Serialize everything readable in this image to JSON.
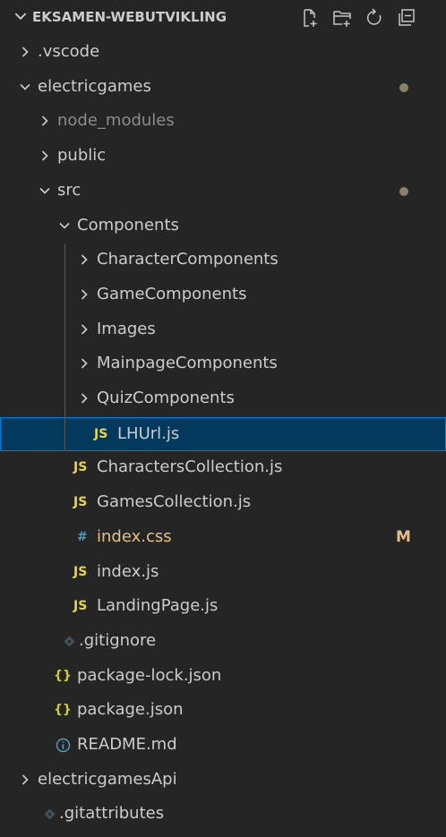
{
  "explorer": {
    "title": "EKSAMEN-WEBUTVIKLING",
    "actions": [
      {
        "name": "new-file-icon"
      },
      {
        "name": "new-folder-icon"
      },
      {
        "name": "refresh-icon"
      },
      {
        "name": "collapse-all-icon"
      }
    ]
  },
  "tree": [
    {
      "label": ".vscode",
      "kind": "folder",
      "expanded": false,
      "depth": 1
    },
    {
      "label": "electricgames",
      "kind": "folder",
      "expanded": true,
      "depth": 1,
      "decoration": "dot"
    },
    {
      "label": "node_modules",
      "kind": "folder",
      "expanded": false,
      "depth": 2,
      "dim": true
    },
    {
      "label": "public",
      "kind": "folder",
      "expanded": false,
      "depth": 2
    },
    {
      "label": "src",
      "kind": "folder",
      "expanded": true,
      "depth": 2,
      "decoration": "dot"
    },
    {
      "label": "Components",
      "kind": "folder",
      "expanded": true,
      "depth": 3
    },
    {
      "label": "CharacterComponents",
      "kind": "folder",
      "expanded": false,
      "depth": 4
    },
    {
      "label": "GameComponents",
      "kind": "folder",
      "expanded": false,
      "depth": 4
    },
    {
      "label": "Images",
      "kind": "folder",
      "expanded": false,
      "depth": 4
    },
    {
      "label": "MainpageComponents",
      "kind": "folder",
      "expanded": false,
      "depth": 4
    },
    {
      "label": "QuizComponents",
      "kind": "folder",
      "expanded": false,
      "depth": 4
    },
    {
      "label": "LHUrl.js",
      "kind": "js",
      "depth": 4,
      "selected": true,
      "icon_text": "JS"
    },
    {
      "label": "CharactersCollection.js",
      "kind": "js",
      "depth": 3,
      "icon_text": "JS"
    },
    {
      "label": "GamesCollection.js",
      "kind": "js",
      "depth": 3,
      "icon_text": "JS"
    },
    {
      "label": "index.css",
      "kind": "css",
      "depth": 3,
      "icon_text": "#",
      "modified": true,
      "badge": "M"
    },
    {
      "label": "index.js",
      "kind": "js",
      "depth": 3,
      "icon_text": "JS"
    },
    {
      "label": "LandingPage.js",
      "kind": "js",
      "depth": 3,
      "icon_text": "JS"
    },
    {
      "label": ".gitignore",
      "kind": "git",
      "depth": 2
    },
    {
      "label": "package-lock.json",
      "kind": "json",
      "depth": 2,
      "icon_text": "{}"
    },
    {
      "label": "package.json",
      "kind": "json",
      "depth": 2,
      "icon_text": "{}"
    },
    {
      "label": "README.md",
      "kind": "info",
      "depth": 2
    },
    {
      "label": "electricgamesApi",
      "kind": "folder",
      "expanded": false,
      "depth": 1
    },
    {
      "label": ".gitattributes",
      "kind": "git",
      "depth": 1
    }
  ],
  "colors": {
    "background": "#252526",
    "selection": "#04395e",
    "selection_border": "#007fd4",
    "modified": "#e2c08d",
    "js": "#e8d44d",
    "css": "#519aba",
    "json": "#cbcb41"
  }
}
